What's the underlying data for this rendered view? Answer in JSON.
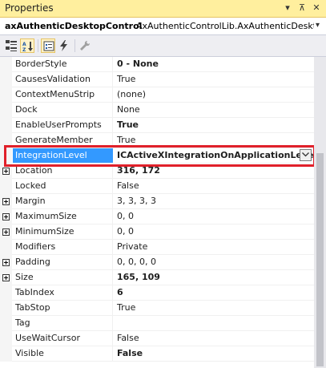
{
  "window": {
    "title": "Properties",
    "pin_glyph": "▾",
    "dock_glyph": "⊼",
    "close_glyph": "✕"
  },
  "object_selector": {
    "name": "axAuthenticDesktopControl",
    "type": "AxAuthenticControlLib.AxAuthenticDeskto",
    "dropdown_glyph": "▾"
  },
  "toolbar": {
    "buttons": [
      {
        "icon": "categorized-icon",
        "active": false
      },
      {
        "icon": "alphabetical-icon",
        "active": true
      },
      {
        "icon": "properties-icon",
        "active": true
      },
      {
        "icon": "events-icon",
        "active": false
      },
      {
        "icon": "property-pages-icon",
        "active": false
      }
    ]
  },
  "properties": [
    {
      "name": "BorderStyle",
      "value": "0 - None",
      "bold": true,
      "expandable": false
    },
    {
      "name": "CausesValidation",
      "value": "True",
      "bold": false,
      "expandable": false
    },
    {
      "name": "ContextMenuStrip",
      "value": "(none)",
      "bold": false,
      "expandable": false
    },
    {
      "name": "Dock",
      "value": "None",
      "bold": false,
      "expandable": false
    },
    {
      "name": "EnableUserPrompts",
      "value": "True",
      "bold": true,
      "expandable": false
    },
    {
      "name": "GenerateMember",
      "value": "True",
      "bold": false,
      "expandable": false
    },
    {
      "name": "IntegrationLevel",
      "value": "ICActiveXIntegrationOnApplicationLevel",
      "bold": true,
      "expandable": false,
      "selected": true
    },
    {
      "name": "Location",
      "value": "316, 172",
      "bold": true,
      "expandable": true
    },
    {
      "name": "Locked",
      "value": "False",
      "bold": false,
      "expandable": false
    },
    {
      "name": "Margin",
      "value": "3, 3, 3, 3",
      "bold": false,
      "expandable": true
    },
    {
      "name": "MaximumSize",
      "value": "0, 0",
      "bold": false,
      "expandable": true
    },
    {
      "name": "MinimumSize",
      "value": "0, 0",
      "bold": false,
      "expandable": true
    },
    {
      "name": "Modifiers",
      "value": "Private",
      "bold": false,
      "expandable": false
    },
    {
      "name": "Padding",
      "value": "0, 0, 0, 0",
      "bold": false,
      "expandable": true
    },
    {
      "name": "Size",
      "value": "165, 109",
      "bold": true,
      "expandable": true
    },
    {
      "name": "TabIndex",
      "value": "6",
      "bold": true,
      "expandable": false
    },
    {
      "name": "TabStop",
      "value": "True",
      "bold": false,
      "expandable": false
    },
    {
      "name": "Tag",
      "value": "",
      "bold": false,
      "expandable": false
    },
    {
      "name": "UseWaitCursor",
      "value": "False",
      "bold": false,
      "expandable": false
    },
    {
      "name": "Visible",
      "value": "False",
      "bold": true,
      "expandable": false
    }
  ],
  "colors": {
    "titlebar": "#ffef9e",
    "selection": "#3399ff",
    "highlight_border": "#e0202a"
  }
}
